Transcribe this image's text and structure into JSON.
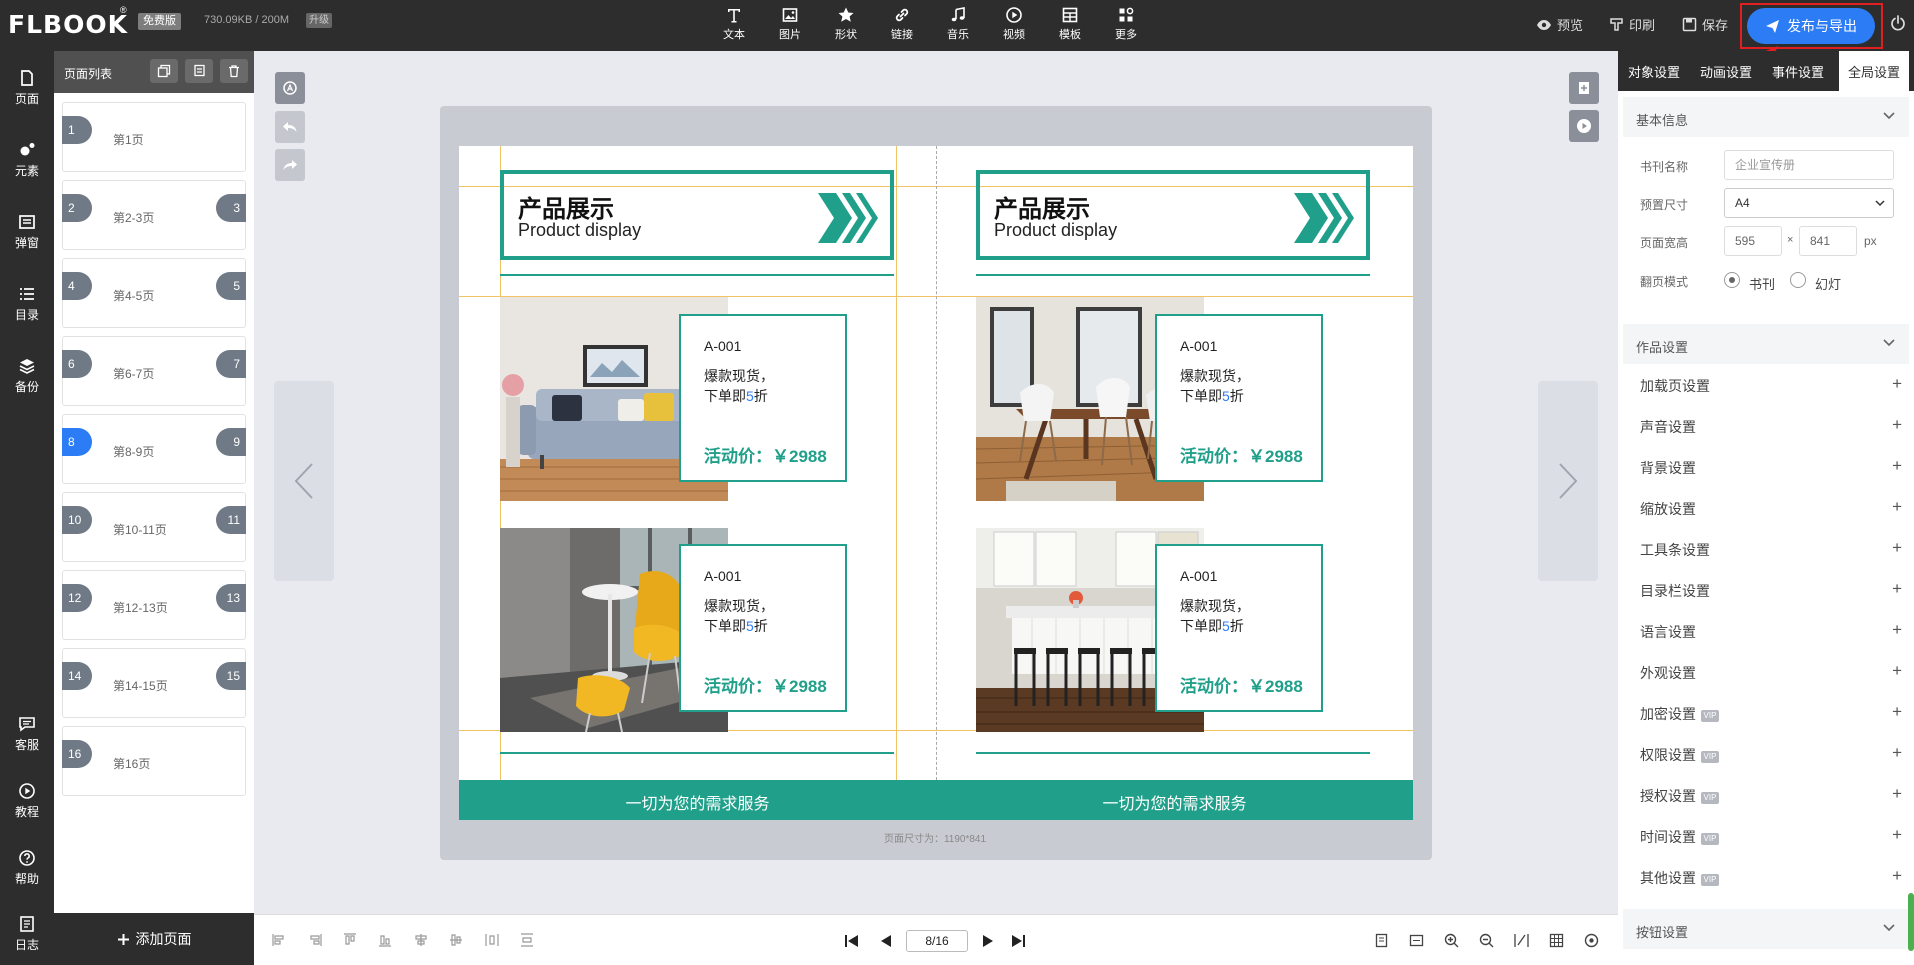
{
  "app": {
    "logo": "FLBOOK",
    "edition": "免费版",
    "storage": "730.09KB / 200M",
    "upgrade": "升级"
  },
  "toolbar": [
    {
      "label": "文本",
      "icon": "text-icon"
    },
    {
      "label": "图片",
      "icon": "image-icon"
    },
    {
      "label": "形状",
      "icon": "star-icon"
    },
    {
      "label": "链接",
      "icon": "link-icon"
    },
    {
      "label": "音乐",
      "icon": "music-icon"
    },
    {
      "label": "视频",
      "icon": "video-icon"
    },
    {
      "label": "模板",
      "icon": "template-icon"
    },
    {
      "label": "更多",
      "icon": "more-icon"
    }
  ],
  "header": {
    "preview": "预览",
    "print": "印刷",
    "save": "保存",
    "publish": "发布与导出"
  },
  "leftnav": [
    {
      "label": "页面",
      "icon": "page-icon"
    },
    {
      "label": "元素",
      "icon": "elements-icon"
    },
    {
      "label": "弹窗",
      "icon": "popup-icon"
    },
    {
      "label": "目录",
      "icon": "list-icon"
    },
    {
      "label": "备份",
      "icon": "layers-icon"
    },
    {
      "label": "客服",
      "icon": "chat-icon"
    },
    {
      "label": "教程",
      "icon": "play-circle-icon"
    },
    {
      "label": "帮助",
      "icon": "help-icon"
    },
    {
      "label": "日志",
      "icon": "log-icon"
    }
  ],
  "pagelist": {
    "title": "页面列表",
    "add_label": "添加页面",
    "items": [
      {
        "left": "1",
        "right": "",
        "label": "第1页",
        "active": false
      },
      {
        "left": "2",
        "right": "3",
        "label": "第2-3页",
        "active": false
      },
      {
        "left": "4",
        "right": "5",
        "label": "第4-5页",
        "active": false
      },
      {
        "left": "6",
        "right": "7",
        "label": "第6-7页",
        "active": false
      },
      {
        "left": "8",
        "right": "9",
        "label": "第8-9页",
        "active": true
      },
      {
        "left": "10",
        "right": "11",
        "label": "第10-11页",
        "active": false
      },
      {
        "left": "12",
        "right": "13",
        "label": "第12-13页",
        "active": false
      },
      {
        "left": "14",
        "right": "15",
        "label": "第14-15页",
        "active": false
      },
      {
        "left": "16",
        "right": "",
        "label": "第16页",
        "active": false
      }
    ]
  },
  "spread": {
    "pages": [
      {
        "title_cn": "产品展示",
        "title_en": "Product display",
        "footer": "一切为您的需求服务",
        "products": [
          {
            "code": "A-001",
            "line1": "爆款现货，",
            "line2_pre": "下单即",
            "line2_num": "5",
            "line2_post": "折",
            "price": "活动价：￥2988",
            "photo": "living-room-sofa-photo"
          },
          {
            "code": "A-001",
            "line1": "爆款现货，",
            "line2_pre": "下单即",
            "line2_num": "5",
            "line2_post": "折",
            "price": "活动价：￥2988",
            "photo": "yellow-chairs-photo"
          }
        ]
      },
      {
        "title_cn": "产品展示",
        "title_en": "Product display",
        "footer": "一切为您的需求服务",
        "products": [
          {
            "code": "A-001",
            "line1": "爆款现货，",
            "line2_pre": "下单即",
            "line2_num": "5",
            "line2_post": "折",
            "price": "活动价：￥2988",
            "photo": "dining-table-photo"
          },
          {
            "code": "A-001",
            "line1": "爆款现货，",
            "line2_pre": "下单即",
            "line2_num": "5",
            "line2_post": "折",
            "price": "活动价：￥2988",
            "photo": "kitchen-island-photo"
          }
        ]
      }
    ],
    "page_size_label": "页面尺寸为：1190*841"
  },
  "pager": {
    "value": "8/16"
  },
  "rightpanel": {
    "tabs": [
      {
        "label": "对象设置",
        "active": false
      },
      {
        "label": "动画设置",
        "active": false
      },
      {
        "label": "事件设置",
        "active": false
      },
      {
        "label": "全局设置",
        "active": true
      }
    ],
    "basic": {
      "title": "基本信息",
      "book_name_label": "书刊名称",
      "book_name_placeholder": "企业宣传册",
      "preset_label": "预置尺寸",
      "preset_value": "A4",
      "wh_label": "页面宽高",
      "width": "595",
      "times": "×",
      "height": "841",
      "unit": "px",
      "flip_label": "翻页模式",
      "flip_opt1": "书刊",
      "flip_opt2": "幻灯"
    },
    "work": {
      "title": "作品设置",
      "items": [
        {
          "label": "加载页设置",
          "vip": false
        },
        {
          "label": "声音设置",
          "vip": false
        },
        {
          "label": "背景设置",
          "vip": false
        },
        {
          "label": "缩放设置",
          "vip": false
        },
        {
          "label": "工具条设置",
          "vip": false
        },
        {
          "label": "目录栏设置",
          "vip": false
        },
        {
          "label": "语言设置",
          "vip": false
        },
        {
          "label": "外观设置",
          "vip": false
        },
        {
          "label": "加密设置",
          "vip": true
        },
        {
          "label": "权限设置",
          "vip": true
        },
        {
          "label": "授权设置",
          "vip": true
        },
        {
          "label": "时间设置",
          "vip": true
        },
        {
          "label": "其他设置",
          "vip": true
        }
      ],
      "vip_label": "VIP"
    },
    "button_settings": {
      "title": "按钮设置"
    }
  },
  "colors": {
    "accent": "#20a08a",
    "primary": "#2b7cf5",
    "dark": "#2d2d2d",
    "guide": "#f2c267"
  }
}
